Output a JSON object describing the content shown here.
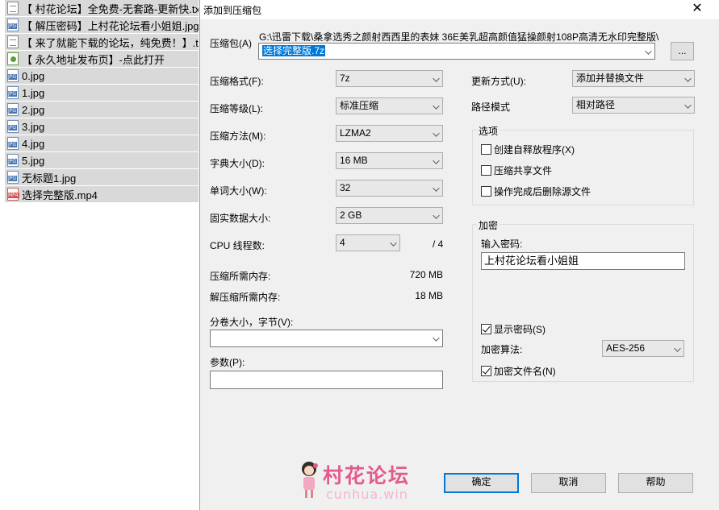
{
  "files": [
    {
      "icon": "txt",
      "name": "【 村花论坛】全免费-无套路-更新快.txt"
    },
    {
      "icon": "jpg",
      "name": "【 解压密码】上村花论坛看小姐姐.jpg"
    },
    {
      "icon": "txt",
      "name": "【 来了就能下载的论坛，纯免费！】.txt"
    },
    {
      "icon": "url",
      "name": "【 永久地址发布页】-点此打开"
    },
    {
      "icon": "jpg",
      "name": "0.jpg"
    },
    {
      "icon": "jpg",
      "name": "1.jpg"
    },
    {
      "icon": "jpg",
      "name": "2.jpg"
    },
    {
      "icon": "jpg",
      "name": "3.jpg"
    },
    {
      "icon": "jpg",
      "name": "4.jpg"
    },
    {
      "icon": "jpg",
      "name": "5.jpg"
    },
    {
      "icon": "jpg",
      "name": "无标题1.jpg"
    },
    {
      "icon": "mp4",
      "name": "选择完整版.mp4"
    }
  ],
  "dialog": {
    "title": "添加到压缩包",
    "close_glyph": "✕",
    "archive": {
      "label": "压缩包(A)",
      "path": "G:\\迅雷下载\\桑拿选秀之颜射西西里的表妹 36E美乳超高颜值猛操颜射108P高清无水印完整版\\",
      "name": "选择完整版.7z",
      "browse_label": "..."
    },
    "left": {
      "format_label": "压缩格式(F):",
      "format_value": "7z",
      "level_label": "压缩等级(L):",
      "level_value": "标准压缩",
      "method_label": "压缩方法(M):",
      "method_value": "LZMA2",
      "dict_label": "字典大小(D):",
      "dict_value": "16 MB",
      "word_label": "单词大小(W):",
      "word_value": "32",
      "solid_label": "固实数据大小:",
      "solid_value": "2 GB",
      "cpu_label": "CPU 线程数:",
      "cpu_value": "4",
      "cpu_total": "/ 4",
      "mem_compress_label": "压缩所需内存:",
      "mem_compress_value": "720 MB",
      "mem_decompress_label": "解压缩所需内存:",
      "mem_decompress_value": "18 MB",
      "volume_label": "分卷大小，字节(V):",
      "volume_value": "",
      "params_label": "参数(P):",
      "params_value": ""
    },
    "right": {
      "update_label": "更新方式(U):",
      "update_value": "添加并替换文件",
      "path_label": "路径模式",
      "path_value": "相对路径",
      "options_title": "选项",
      "opt_sfx": "创建自释放程序(X)",
      "opt_shared": "压缩共享文件",
      "opt_delete": "操作完成后删除源文件",
      "encrypt_title": "加密",
      "password_label": "输入密码:",
      "password_value": "上村花论坛看小姐姐",
      "show_password": "显示密码(S)",
      "algo_label": "加密算法:",
      "algo_value": "AES-256",
      "encrypt_names": "加密文件名(N)"
    },
    "buttons": {
      "ok": "确定",
      "cancel": "取消",
      "help": "帮助"
    },
    "watermark": {
      "title": "村花论坛",
      "domain": "cunhua.win"
    }
  }
}
